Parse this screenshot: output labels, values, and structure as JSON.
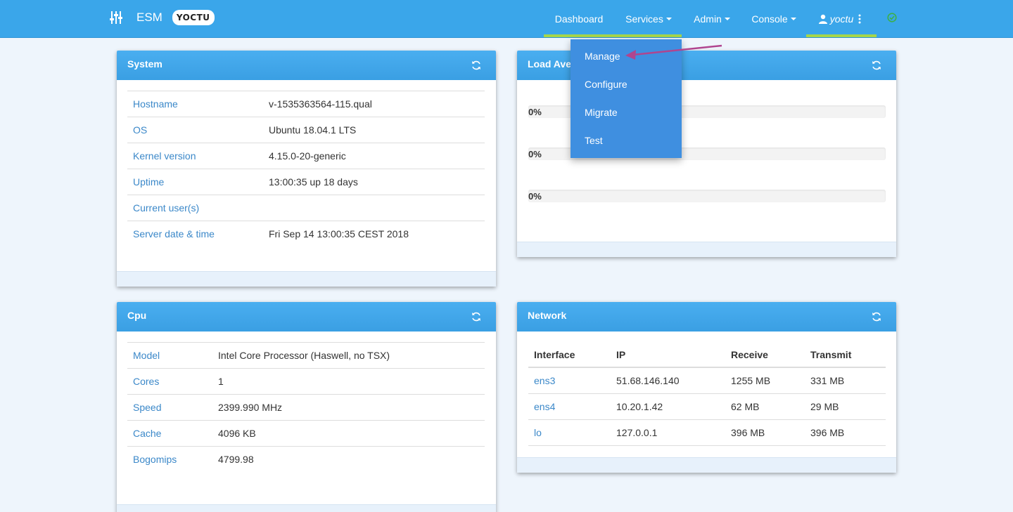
{
  "brand": {
    "title": "ESM",
    "badge": "YOCTU"
  },
  "nav": {
    "dashboard": "Dashboard",
    "services": "Services",
    "admin": "Admin",
    "console": "Console",
    "user": "yoctu"
  },
  "services_menu": [
    "Manage",
    "Configure",
    "Migrate",
    "Test"
  ],
  "system": {
    "title": "System",
    "rows": [
      {
        "key": "Hostname",
        "value": "v-1535363564-115.qual"
      },
      {
        "key": "OS",
        "value": "Ubuntu 18.04.1 LTS"
      },
      {
        "key": "Kernel version",
        "value": "4.15.0-20-generic"
      },
      {
        "key": "Uptime",
        "value": "13:00:35 up 18 days"
      },
      {
        "key": "Current user(s)",
        "value": ""
      },
      {
        "key": "Server date & time",
        "value": "Fri Sep 14 13:00:35 CEST 2018"
      }
    ]
  },
  "load": {
    "title": "Load Ave",
    "bars": [
      {
        "label": "0%",
        "value": 0
      },
      {
        "label": "0%",
        "value": 0
      },
      {
        "label": "0%",
        "value": 0
      }
    ]
  },
  "cpu": {
    "title": "Cpu",
    "rows": [
      {
        "key": "Model",
        "value": "Intel Core Processor (Haswell, no TSX)"
      },
      {
        "key": "Cores",
        "value": "1"
      },
      {
        "key": "Speed",
        "value": "2399.990 MHz"
      },
      {
        "key": "Cache",
        "value": "4096 KB"
      },
      {
        "key": "Bogomips",
        "value": "4799.98"
      }
    ]
  },
  "network": {
    "title": "Network",
    "headers": [
      "Interface",
      "IP",
      "Receive",
      "Transmit"
    ],
    "rows": [
      [
        "ens3",
        "51.68.146.140",
        "1255 MB",
        "331 MB"
      ],
      [
        "ens4",
        "10.20.1.42",
        "62 MB",
        "29 MB"
      ],
      [
        "lo",
        "127.0.0.1",
        "396 MB",
        "396 MB"
      ]
    ]
  },
  "colors": {
    "navbar": "#3aa6ea",
    "active_indicator": "#a6d64a",
    "link": "#3b88c9",
    "dropdown": "#3f8fe0",
    "annotation_arrow": "#b0458f",
    "status_ok": "#3cb04a"
  }
}
